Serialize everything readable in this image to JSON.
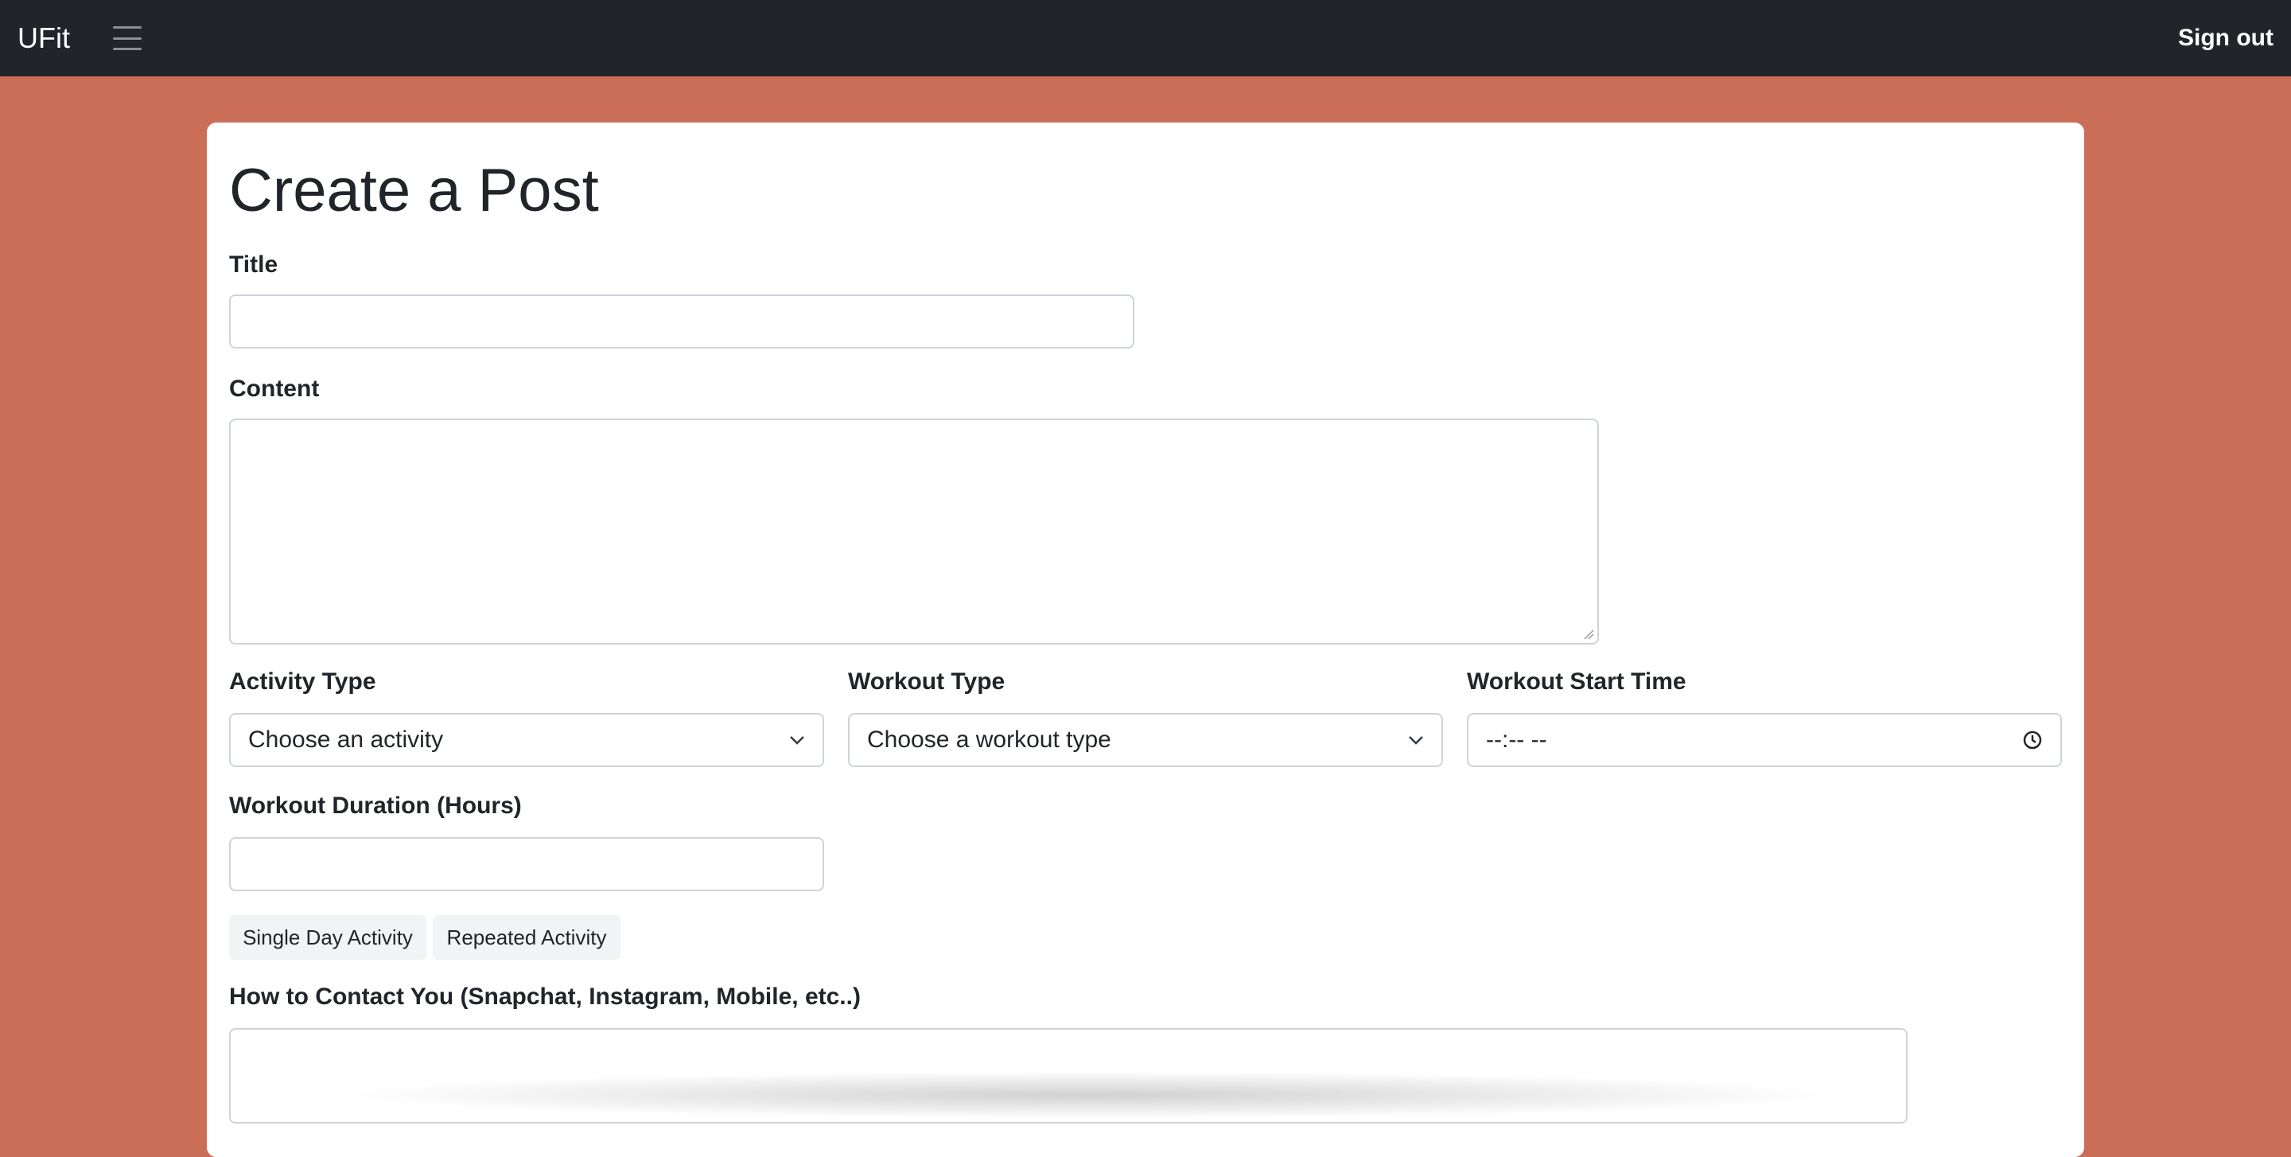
{
  "navbar": {
    "brand": "UFit",
    "menu_icon": "hamburger-menu-icon",
    "signout_label": "Sign out"
  },
  "form": {
    "page_title": "Create a Post",
    "title_label": "Title",
    "title_value": "",
    "content_label": "Content",
    "content_value": "",
    "activity_type_label": "Activity Type",
    "activity_type_value": "Choose an activity",
    "workout_type_label": "Workout Type",
    "workout_type_value": "Choose a workout type",
    "start_time_label": "Workout Start Time",
    "start_time_value": "--:-- --",
    "duration_label": "Workout Duration (Hours)",
    "duration_value": "",
    "single_day_label": "Single Day Activity",
    "repeated_label": "Repeated Activity",
    "contact_label": "How to Contact You (Snapchat, Instagram, Mobile, etc..)",
    "contact_value": ""
  },
  "colors": {
    "navbar_bg": "#212529",
    "page_bg": "#cb6e58",
    "card_bg": "#ffffff"
  }
}
